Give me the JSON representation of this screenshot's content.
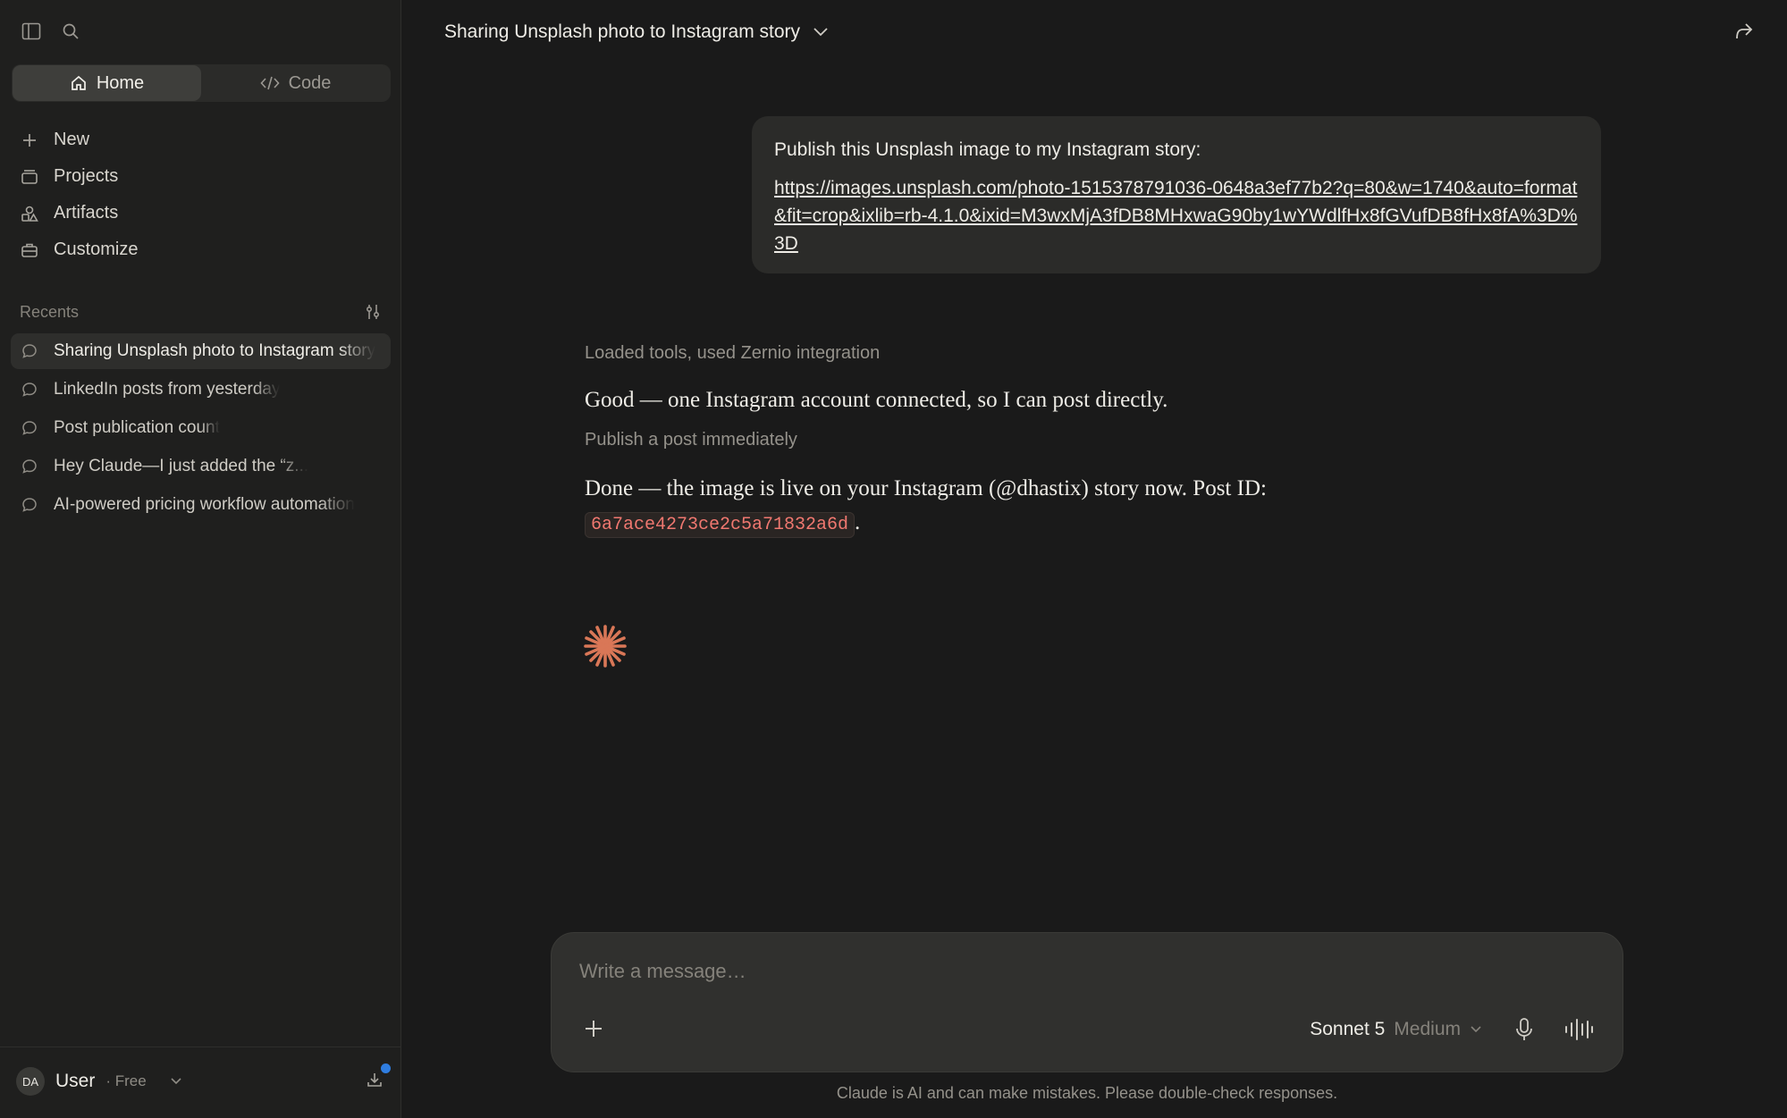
{
  "sidebar": {
    "modes": [
      {
        "label": "Home",
        "active": true
      },
      {
        "label": "Code",
        "active": false
      }
    ],
    "nav": [
      {
        "label": "New",
        "icon": "plus-icon"
      },
      {
        "label": "Projects",
        "icon": "folder-icon"
      },
      {
        "label": "Artifacts",
        "icon": "shapes-icon"
      },
      {
        "label": "Customize",
        "icon": "briefcase-icon"
      }
    ],
    "recents_title": "Recents",
    "recents": [
      {
        "label": "Sharing Unsplash photo to Instagram story",
        "active": true
      },
      {
        "label": "LinkedIn posts from yesterday"
      },
      {
        "label": "Post publication count"
      },
      {
        "label": "Hey Claude—I just added the “z..."
      },
      {
        "label": "AI-powered pricing workflow automation"
      }
    ],
    "user": {
      "initials": "DA",
      "name": "User",
      "plan": "· Free"
    }
  },
  "chat": {
    "title": "Sharing Unsplash photo to Instagram story",
    "user_message": {
      "text": "Publish this Unsplash image to my Instagram story:",
      "link": "https://images.unsplash.com/photo-1515378791036-0648a3ef77b2?q=80&w=1740&auto=format&fit=crop&ixlib=rb-4.1.0&ixid=M3wxMjA3fDB8MHxwaG90by1wYWdlfHx8fGVufDB8fHx8fA%3D%3D"
    },
    "assistant": {
      "tool_line_1": "Loaded tools, used Zernio integration",
      "response_1": "Good — one Instagram account connected, so I can post directly.",
      "tool_line_2": "Publish a post immediately",
      "response_2": "Done — the image is live on your Instagram (@dhastix) story now. Post ID:",
      "post_id": "6a7ace4273ce2c5a71832a6d",
      "response_2_end": "."
    }
  },
  "composer": {
    "placeholder": "Write a message…",
    "model_name": "Sonnet 5",
    "model_effort": "Medium"
  },
  "disclaimer": "Claude is AI and can make mistakes. Please double-check responses.",
  "colors": {
    "accent": "#d97757",
    "code": "#f07870",
    "notification": "#2f7de0"
  }
}
